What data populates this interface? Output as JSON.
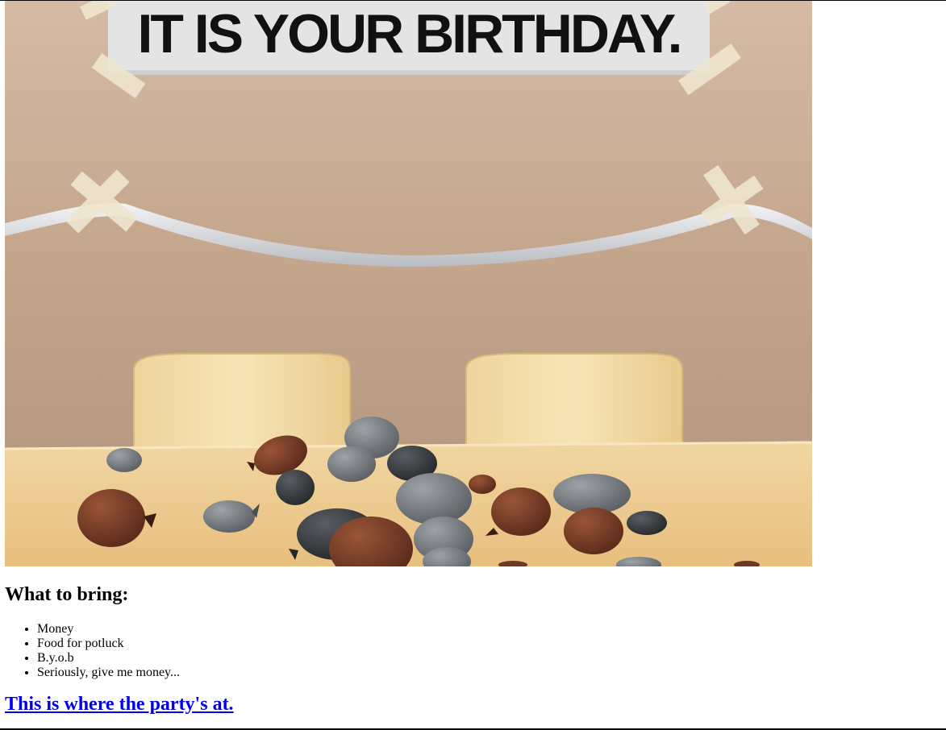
{
  "banner": {
    "text": "IT IS YOUR BIRTHDAY."
  },
  "bring": {
    "heading": "What to bring:",
    "items": [
      "Money",
      "Food for potluck",
      "B.y.o.b",
      "Seriously, give me money..."
    ]
  },
  "party_link": {
    "text": "This is where the party's at."
  },
  "colors": {
    "wall": "#c9ac93",
    "table": "#f0cc8f",
    "chair": "#f3dca6",
    "banner_paper": "#e6e6e6",
    "tape": "#efe6cf",
    "balloon_gray": "#7d8185",
    "balloon_brown": "#7a3f2a",
    "link": "#0000ee"
  }
}
